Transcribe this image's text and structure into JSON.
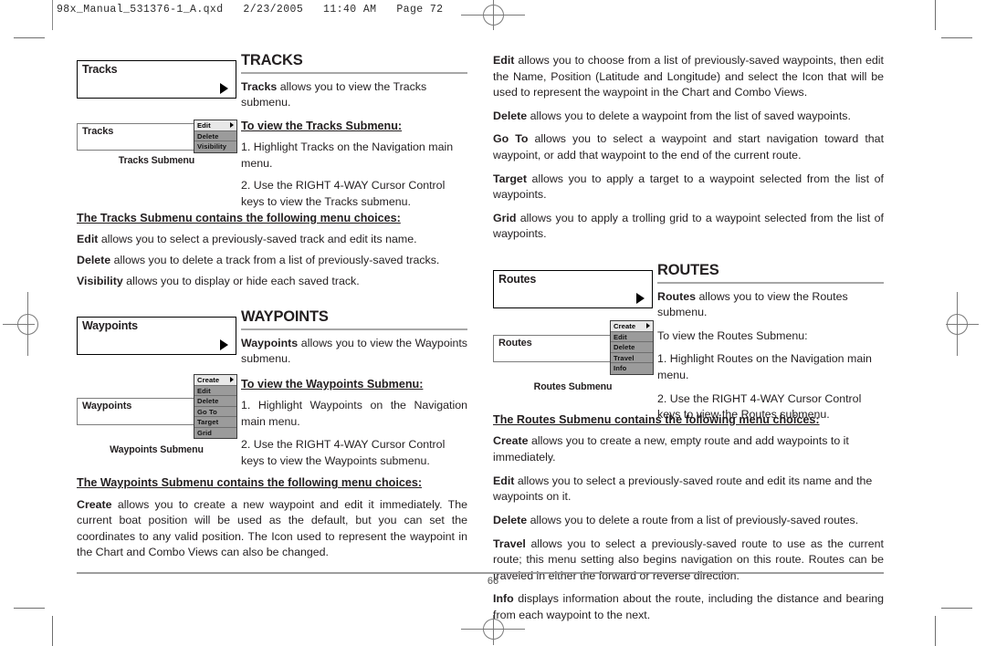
{
  "slug": {
    "text": "98x_Manual_531376-1_A.qxd   2/23/2005   11:40 AM   Page 72"
  },
  "footer": {
    "page_number": "66"
  },
  "left_column": {
    "tracks": {
      "menu_box_label": "Tracks",
      "heading": "TRACKS",
      "intro_bold": "Tracks",
      "intro_rest": " allows you to view the Tracks submenu.",
      "subhead": "To view the Tracks Submenu:",
      "step1": "1. Highlight Tracks on the Navigation main menu.",
      "step2": "2. Use the RIGHT 4-WAY Cursor Control keys to view the Tracks submenu.",
      "submenu_box_label": "Tracks",
      "submenu_caption": "Tracks Submenu",
      "submenu_items": [
        {
          "label": "Edit",
          "selected": true,
          "arrow": true
        },
        {
          "label": "Delete",
          "selected": false,
          "arrow": false
        },
        {
          "label": "Visibility",
          "selected": false,
          "arrow": false
        }
      ],
      "choices_head": "The Tracks Submenu contains the following menu choices:",
      "choices": [
        {
          "term": "Edit",
          "desc": " allows you to select a previously-saved track and edit its name."
        },
        {
          "term": "Delete",
          "desc": " allows you to delete a track from a list of previously-saved tracks."
        },
        {
          "term": "Visibility",
          "desc": " allows you to display or hide each saved track."
        }
      ]
    },
    "waypoints": {
      "menu_box_label": "Waypoints",
      "heading": "WAYPOINTS",
      "intro_bold": "Waypoints",
      "intro_rest": " allows you to view the Waypoints submenu.",
      "subhead": "To view the Waypoints Submenu:",
      "step1": "1. Highlight Waypoints on the Navigation main menu.",
      "step2": "2. Use the RIGHT 4-WAY Cursor Control keys to view the Waypoints submenu.",
      "submenu_box_label": "Waypoints",
      "submenu_caption": "Waypoints Submenu",
      "submenu_items": [
        {
          "label": "Create",
          "selected": true,
          "arrow": true
        },
        {
          "label": "Edit",
          "selected": false,
          "arrow": false
        },
        {
          "label": "Delete",
          "selected": false,
          "arrow": false
        },
        {
          "label": "Go To",
          "selected": false,
          "arrow": false
        },
        {
          "label": "Target",
          "selected": false,
          "arrow": false
        },
        {
          "label": "Grid",
          "selected": false,
          "arrow": false
        }
      ],
      "choices_head": "The Waypoints Submenu contains the following menu choices:",
      "create_term": "Create",
      "create_desc": " allows you to create a new waypoint and edit it immediately. The current boat position will be used as the default, but you can set the coordinates to any valid position. The Icon used to represent the waypoint in the Chart and Combo Views can also be changed."
    }
  },
  "right_column": {
    "waypoints_continued": [
      {
        "term": "Edit",
        "desc": " allows you to choose from a list of previously-saved waypoints, then edit the Name, Position (Latitude and Longitude) and select the Icon that will be used to represent the waypoint in the Chart and Combo Views."
      },
      {
        "term": "Delete",
        "desc": " allows you to delete a waypoint from the list of saved waypoints."
      },
      {
        "term": "Go To",
        "desc": " allows you to select a waypoint and start navigation toward that waypoint, or add that waypoint to the end of the current route."
      },
      {
        "term": "Target",
        "desc": " allows you to apply a target to a waypoint selected from the list of waypoints."
      },
      {
        "term": "Grid",
        "desc": " allows you to apply a trolling grid to a waypoint selected from the list of waypoints."
      }
    ],
    "routes": {
      "menu_box_label": "Routes",
      "heading": "ROUTES",
      "intro_bold": "Routes",
      "intro_rest": " allows you to view the Routes submenu.",
      "subhead": "To view the Routes Submenu:",
      "step1": "1.  Highlight Routes on the Navigation main menu.",
      "step2": "2. Use the RIGHT 4-WAY Cursor Control keys to view the Routes submenu.",
      "submenu_box_label": "Routes",
      "submenu_caption": "Routes Submenu",
      "submenu_items": [
        {
          "label": "Create",
          "selected": true,
          "arrow": true
        },
        {
          "label": "Edit",
          "selected": false,
          "arrow": false
        },
        {
          "label": "Delete",
          "selected": false,
          "arrow": false
        },
        {
          "label": "Travel",
          "selected": false,
          "arrow": false
        },
        {
          "label": "Info",
          "selected": false,
          "arrow": false
        }
      ],
      "choices_head": "The Routes Submenu contains the following menu choices:",
      "choices": [
        {
          "term": "Create",
          "desc": " allows you to create a new, empty route and add waypoints to it immediately."
        },
        {
          "term": "Edit",
          "desc": " allows you to select a previously-saved route and edit its name and the waypoints on it."
        },
        {
          "term": "Delete",
          "desc": " allows you to delete a route from a list of previously-saved routes."
        },
        {
          "term": "Travel",
          "desc": " allows you to select a previously-saved route to use as the current route; this menu setting also begins navigation on this route. Routes can be traveled in either the forward or reverse direction."
        },
        {
          "term": "Info",
          "desc": " displays information about the route, including the distance and bearing from each waypoint to the next."
        }
      ]
    }
  }
}
